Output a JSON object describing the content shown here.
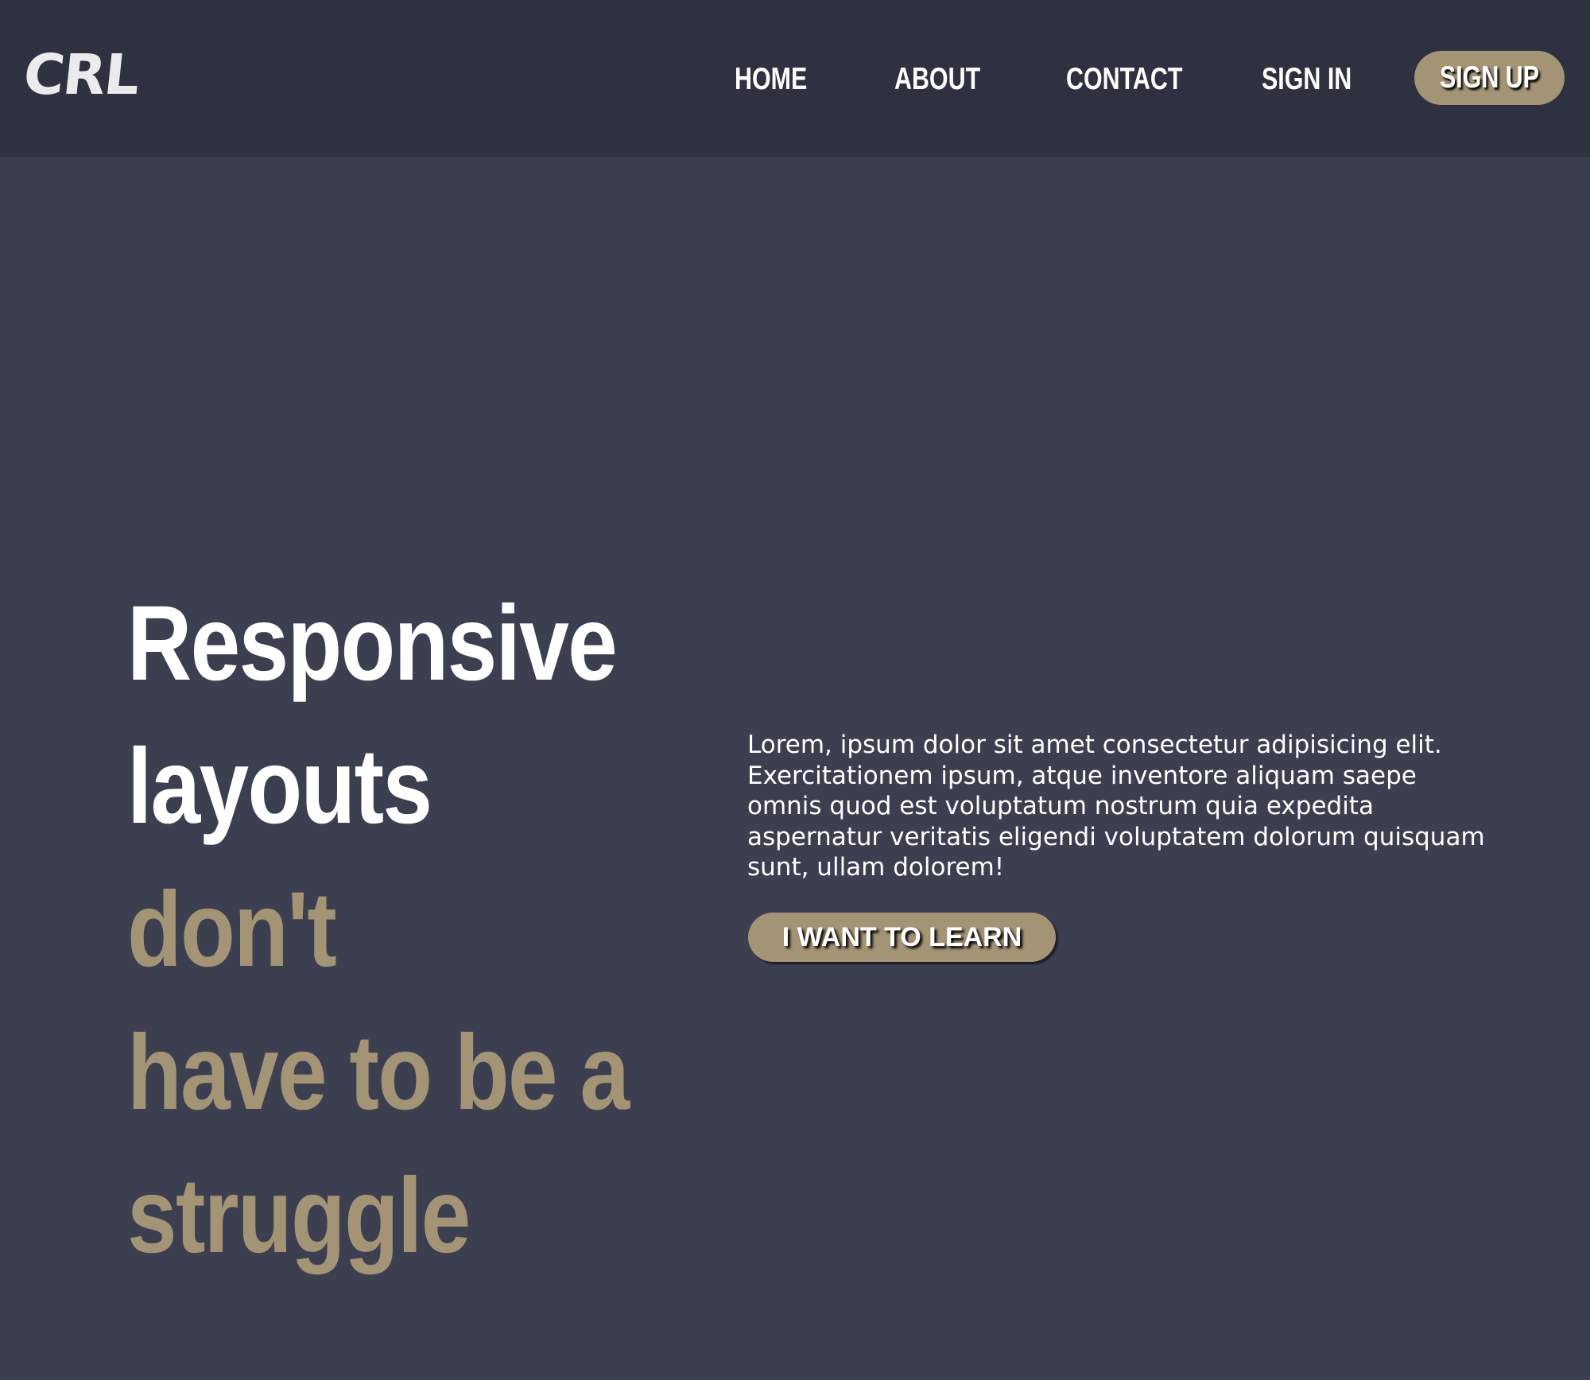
{
  "navbar": {
    "logo": "CRL",
    "links": [
      {
        "label": "HOME"
      },
      {
        "label": "ABOUT"
      },
      {
        "label": "CONTACT"
      },
      {
        "label": "SIGN IN"
      }
    ],
    "signup_label": "SIGN UP"
  },
  "hero": {
    "headline_white_1": "Responsive",
    "headline_white_2": "layouts",
    "headline_gold_1": "don't",
    "headline_gold_2": "have to be a",
    "headline_gold_3": "struggle",
    "description": "Lorem, ipsum dolor sit amet consectetur adipisicing elit. Exercitationem ipsum, atque inventore aliquam saepe omnis quod est voluptatum nostrum quia expedita aspernatur veritatis eligendi voluptatem dolorum quisquam sunt, ullam dolorem!",
    "cta_label": "I WANT TO LEARN"
  },
  "colors": {
    "navbar_bg": "#2e313f",
    "page_bg": "#3b3f50",
    "accent": "#a49476",
    "text": "#ffffff"
  }
}
